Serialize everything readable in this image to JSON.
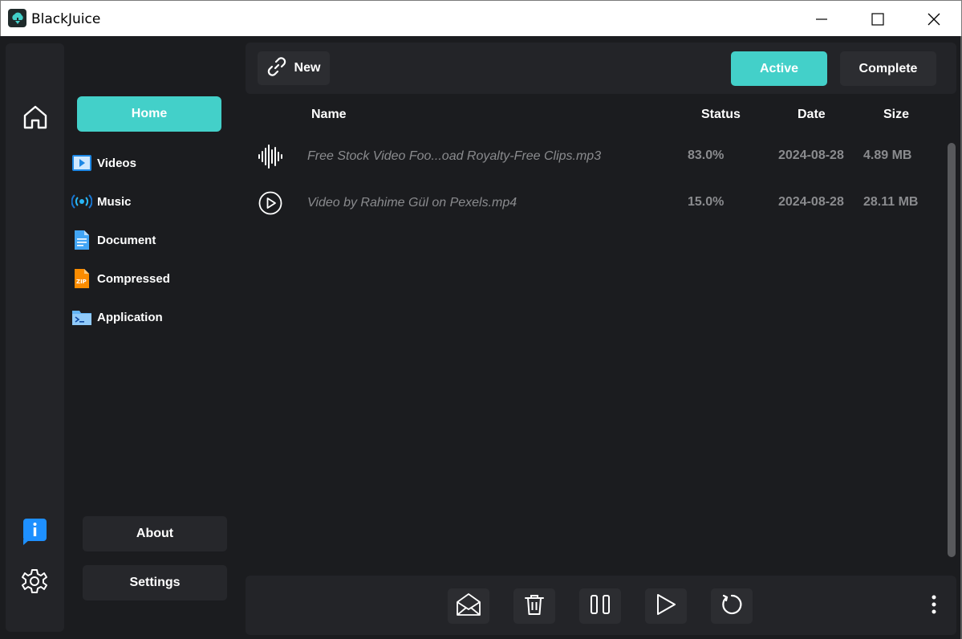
{
  "window": {
    "title": "BlackJuice"
  },
  "nav": {
    "home_label": "Home",
    "items": [
      {
        "label": "Videos",
        "icon": "video-file-icon"
      },
      {
        "label": "Music",
        "icon": "broadcast-icon"
      },
      {
        "label": "Document",
        "icon": "document-icon"
      },
      {
        "label": "Compressed",
        "icon": "zip-icon"
      },
      {
        "label": "Application",
        "icon": "terminal-folder-icon"
      }
    ],
    "about_label": "About",
    "settings_label": "Settings"
  },
  "toolbar": {
    "new_label": "New",
    "active_label": "Active",
    "complete_label": "Complete"
  },
  "table": {
    "headers": {
      "name": "Name",
      "status": "Status",
      "date": "Date",
      "size": "Size"
    },
    "rows": [
      {
        "icon": "audio-wave-icon",
        "name": "Free Stock Video Foo...oad Royalty-Free Clips.mp3",
        "status": "83.0%",
        "date": "2024-08-28",
        "size": "4.89 MB"
      },
      {
        "icon": "play-circle-icon",
        "name": "Video by Rahime Gül on Pexels.mp4",
        "status": "15.0%",
        "date": "2024-08-28",
        "size": "28.11 MB"
      }
    ]
  },
  "colors": {
    "accent": "#43d0c9",
    "background": "#1b1c1f",
    "panel": "#232428",
    "button": "#2c2d31",
    "muted_text": "#8a8b8e",
    "info_blue": "#1e90ff"
  },
  "actions": [
    "open-mail-icon",
    "trash-icon",
    "pause-icon",
    "play-icon",
    "refresh-icon",
    "more-vertical-icon"
  ]
}
